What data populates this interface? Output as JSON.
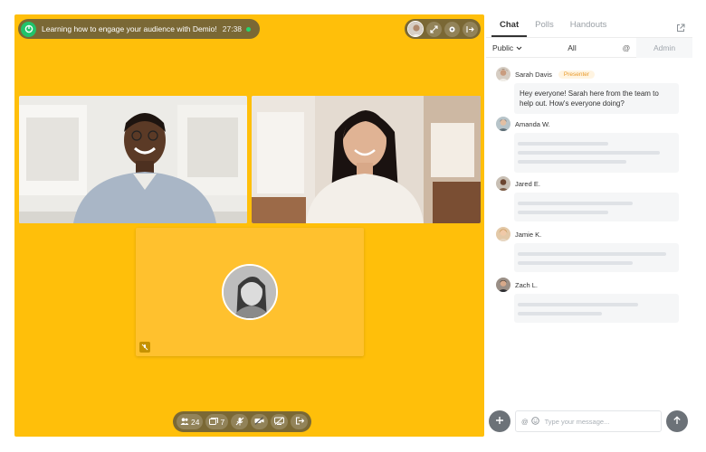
{
  "session": {
    "title": "Learning how to engage your audience with Demio!",
    "timer": "27:38"
  },
  "toolbar": {
    "attendees_count": "24",
    "handouts_count": "7"
  },
  "chat_panel": {
    "tabs": [
      {
        "label": "Chat",
        "active": true
      },
      {
        "label": "Polls",
        "active": false
      },
      {
        "label": "Handouts",
        "active": false
      }
    ],
    "filters": {
      "visibility": "Public",
      "all": "All",
      "mention": "@",
      "admin": "Admin"
    },
    "messages": [
      {
        "name": "Sarah Davis",
        "badge": "Presenter",
        "text": "Hey everyone! Sarah here from the team to help out. How's everyone doing?"
      },
      {
        "name": "Amanda W.",
        "skeleton_lines": [
          0.55,
          0.86,
          0.66
        ]
      },
      {
        "name": "Jared E.",
        "skeleton_lines": [
          0.7,
          0.55
        ]
      },
      {
        "name": "Jamie K.",
        "skeleton_lines": [
          0.9,
          0.7
        ]
      },
      {
        "name": "Zach L.",
        "skeleton_lines": [
          0.73,
          0.51
        ]
      }
    ],
    "composer": {
      "placeholder": "Type your message..."
    }
  },
  "colors": {
    "stage_bg": "#FFBF0A",
    "brand_green": "#21C36B",
    "presenter_badge": "#E89A2A"
  },
  "icons": [
    "demio-logo-icon",
    "expand-icon",
    "gear-icon",
    "exit-icon",
    "attendees-icon",
    "handouts-icon",
    "mic-off-icon",
    "camera-off-icon",
    "screen-share-off-icon",
    "leave-icon",
    "popout-icon",
    "chevron-down-icon",
    "plus-icon",
    "emoji-icon",
    "send-arrow-icon"
  ]
}
